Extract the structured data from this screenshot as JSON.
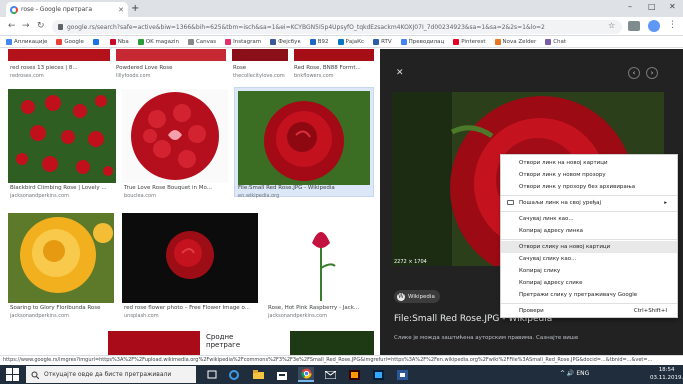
{
  "browser": {
    "tab_title": "rose - Google претрага",
    "new_tab": "+",
    "win_min": "–",
    "win_max": "□",
    "win_close": "✕",
    "back": "←",
    "forward": "→",
    "reload": "↻",
    "url": "google.rs/search?safe=active&biw=1366&bih=625&tbm=isch&sa=1&ei=KCYBGN5I5p4UpsyfO_tqkdEzsackm4KOXJ07I_7d00234923&sa=1&sa=2&2s=1&lo=2",
    "star": "☆",
    "menu": "⋮"
  },
  "bookmarks": [
    {
      "label": "Апликације",
      "color": "#4285f4"
    },
    {
      "label": "Google",
      "color": "#ea4335"
    },
    {
      "label": "",
      "color": "#1a73e8"
    },
    {
      "label": "Nba",
      "color": "#c9082a"
    },
    {
      "label": "OK magazin",
      "color": "#2a9d3a"
    },
    {
      "label": "Canvas",
      "color": "#888888"
    },
    {
      "label": "Instagram",
      "color": "#e1306c"
    },
    {
      "label": "Фејсбук",
      "color": "#3b5998"
    },
    {
      "label": "B92",
      "color": "#1e66c8"
    },
    {
      "label": "РајаКс",
      "color": "#0a74c4"
    },
    {
      "label": "RTV",
      "color": "#2c5ea6"
    },
    {
      "label": "Преводилац",
      "color": "#4285f4"
    },
    {
      "label": "Pinterest",
      "color": "#e60023"
    },
    {
      "label": "Nova Zelder",
      "color": "#e87722"
    },
    {
      "label": "Chat",
      "color": "#7b5ea7"
    }
  ],
  "results": {
    "top_row": [
      {
        "caption": "red roses 13 pieces | 8...",
        "source": "redroses.com"
      },
      {
        "caption": "Powdered Love Rose",
        "source": "lillyfoods.com"
      },
      {
        "caption": "Rose",
        "source": "thecollecitylove.com"
      },
      {
        "caption": "Red Rose, BN88 Formt...",
        "source": "bnkflowers.com"
      }
    ],
    "row2": [
      {
        "caption": "Blackbird Climbing Rose | Lovely ...",
        "source": "jacksonandperkins.com"
      },
      {
        "caption": "True Love Rose Bouquet in Mo...",
        "source": "bouclea.com"
      },
      {
        "caption": "File:Small Red Rose.JPG - Wikipedia",
        "source": "en.wikipedia.org"
      }
    ],
    "row3": [
      {
        "caption": "Soaring to Glory Floribunda Rose",
        "source": "jacksonandperkins.com"
      },
      {
        "caption": "red rose flower photo – Free Flower Image o...",
        "source": "unsplash.com"
      },
      {
        "caption": "Rose, Hot Pink Raspberry - Jack...",
        "source": "jacksonandperkins.com"
      }
    ],
    "row4": [
      {
        "caption": "Сродне претраге",
        "source": ""
      }
    ]
  },
  "preview": {
    "close": "✕",
    "share": "⤴",
    "prev": "‹",
    "next": "›",
    "dimensions": "2272 × 1704",
    "source": "Wikipedia",
    "title": "File:Small Red Rose.JPG - Wikipedia",
    "note": "Слике је можда заштићена ауторским правима. Сазнајте више"
  },
  "context_menu": {
    "items": [
      {
        "label": "Отвори линк на новој картици",
        "shortcut": ""
      },
      {
        "label": "Отвори линк у новом прозору",
        "shortcut": ""
      },
      {
        "label": "Отвори линк у прозору без архивирања",
        "shortcut": ""
      },
      {
        "label": "Пошаљи линк на свој уређај",
        "shortcut": "▸"
      },
      {
        "label": "Сачувај линк као...",
        "shortcut": ""
      },
      {
        "label": "Копирај адресу линка",
        "shortcut": ""
      },
      {
        "label": "Отвори слику на новој картици",
        "shortcut": ""
      },
      {
        "label": "Сачувај слику као...",
        "shortcut": ""
      },
      {
        "label": "Копирај слику",
        "shortcut": ""
      },
      {
        "label": "Копирај адресу слике",
        "shortcut": ""
      },
      {
        "label": "Претражи слику у претраживачу Google",
        "shortcut": ""
      },
      {
        "label": "Провери",
        "shortcut": "Ctrl+Shift+I"
      }
    ]
  },
  "status_bar": "https://www.google.rs/imgres?imgurl=https%3A%2F%2Fupload.wikimedia.org%2Fwikipedia%2Fcommons%2F3%2F3e%2FSmall_Red_Rose.JPG&imgrefurl=https%3A%2F%2Fen.wikipedia.org%2Fwiki%2FFile%3ASmall_Red_Rose.JPG&docid=...&tbnid=...&vet=...",
  "taskbar": {
    "search_placeholder": "Откуцајте овде да бисте претраживали",
    "tray": "^ 🔊 ENG",
    "time": "18:54",
    "date": "03.11.2019."
  }
}
